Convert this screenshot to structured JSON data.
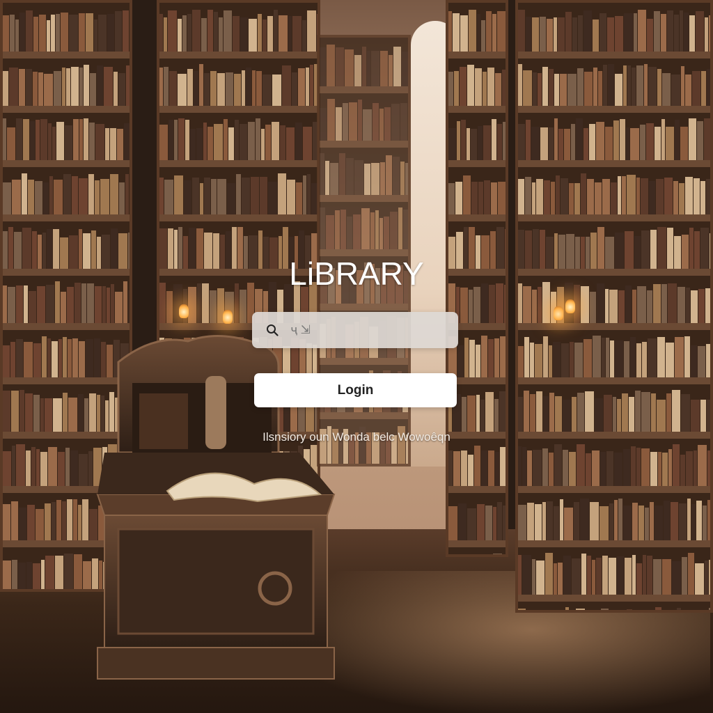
{
  "header": {
    "title": "LiBRARY"
  },
  "search": {
    "value": "",
    "placeholder": "ҷ ⇲"
  },
  "login": {
    "label": "Login"
  },
  "footer": {
    "tagline": "Ilsnsiory oun Wonda belc Wowoêqn"
  },
  "icons": {
    "search": "search-icon"
  },
  "colors": {
    "accent": "#ffffff",
    "wood": "#5a3a26",
    "warm_light": "#ffb24a"
  }
}
